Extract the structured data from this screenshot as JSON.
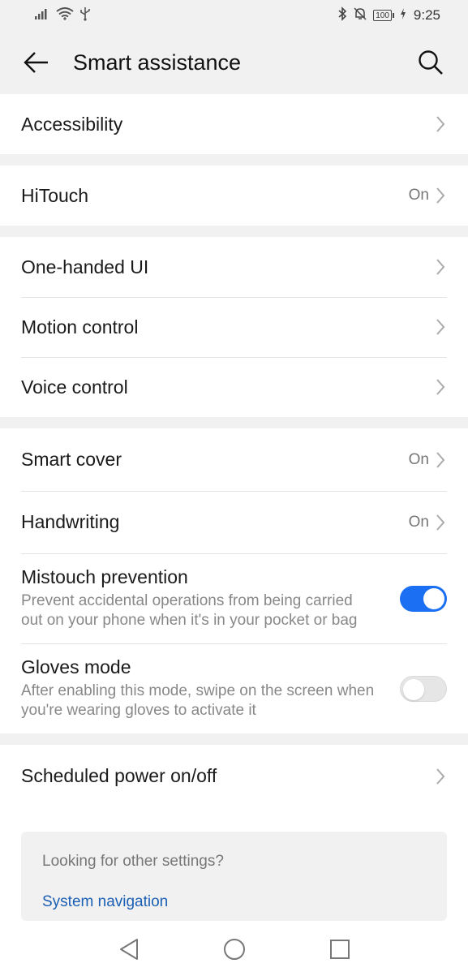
{
  "status": {
    "time": "9:25",
    "battery": "100",
    "icons": [
      "signal-icon",
      "wifi-icon",
      "usb-icon",
      "bluetooth-icon",
      "mute-icon",
      "battery-icon",
      "charging-icon"
    ]
  },
  "header": {
    "title": "Smart assistance",
    "back_icon": "back-arrow-icon",
    "search_icon": "search-icon"
  },
  "groups": {
    "g1": [
      {
        "label": "Accessibility",
        "value": ""
      }
    ],
    "g2": [
      {
        "label": "HiTouch",
        "value": "On"
      }
    ],
    "g3": [
      {
        "label": "One-handed UI",
        "value": ""
      },
      {
        "label": "Motion control",
        "value": ""
      },
      {
        "label": "Voice control",
        "value": ""
      }
    ],
    "g4": [
      {
        "label": "Smart cover",
        "value": "On"
      },
      {
        "label": "Handwriting",
        "value": "On"
      },
      {
        "label": "Mistouch prevention",
        "desc": "Prevent accidental operations from being carried out on your phone when it's in your pocket or bag",
        "toggle": true
      },
      {
        "label": "Gloves mode",
        "desc": "After enabling this mode, swipe on the screen when you're wearing gloves to activate it",
        "toggle": false
      }
    ],
    "g5": [
      {
        "label": "Scheduled power on/off",
        "value": ""
      }
    ]
  },
  "other_settings": {
    "title": "Looking for other settings?",
    "link": "System navigation"
  },
  "nav": {
    "back": "nav-back-icon",
    "home": "nav-home-icon",
    "recents": "nav-recents-icon"
  },
  "colors": {
    "accent": "#1a6ff2",
    "link": "#1a5fb4",
    "background": "#f1f1f1"
  }
}
